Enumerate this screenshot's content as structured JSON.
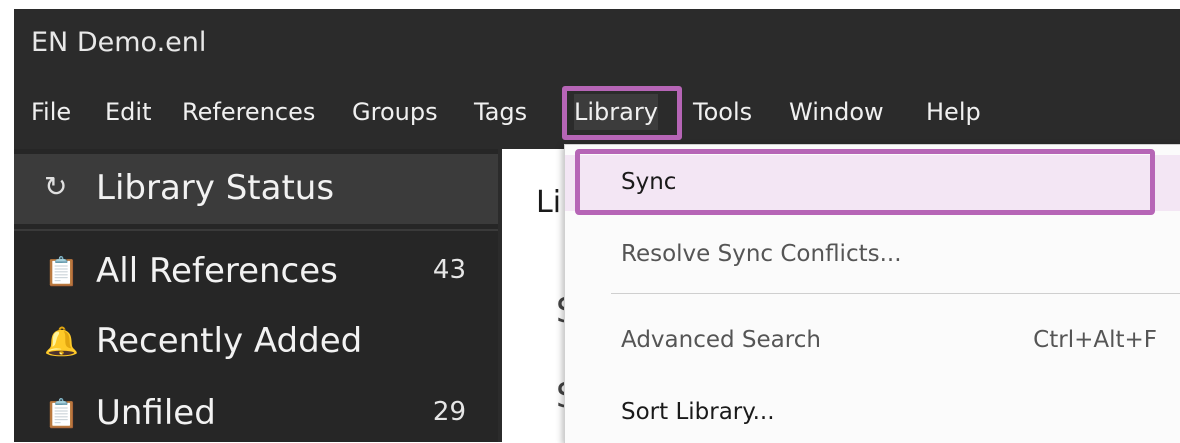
{
  "window": {
    "title": "EN Demo.enl"
  },
  "menubar": {
    "items": [
      "File",
      "Edit",
      "References",
      "Groups",
      "Tags",
      "Library",
      "Tools",
      "Window",
      "Help"
    ]
  },
  "sidebar": {
    "status": {
      "icon": "sync-icon",
      "label": "Library Status"
    },
    "items": [
      {
        "icon": "clipboard-icon",
        "label": "All References",
        "count": "43"
      },
      {
        "icon": "bell-icon",
        "label": "Recently Added",
        "count": ""
      },
      {
        "icon": "clipboard-icon",
        "label": "Unfiled",
        "count": "29"
      }
    ]
  },
  "content": {
    "heading_partial": "Li",
    "s1": "S",
    "s2": "S"
  },
  "library_menu": {
    "items": [
      {
        "label": "Sync",
        "shortcut": ""
      },
      {
        "label": "Resolve Sync Conflicts...",
        "shortcut": ""
      },
      {
        "label": "Advanced Search",
        "shortcut": "Ctrl+Alt+F"
      },
      {
        "label": "Sort Library...",
        "shortcut": ""
      }
    ]
  },
  "colors": {
    "highlight": "#b665b6",
    "sync_bg": "#f3e6f4",
    "titlebar_bg": "#2b2b2b"
  }
}
